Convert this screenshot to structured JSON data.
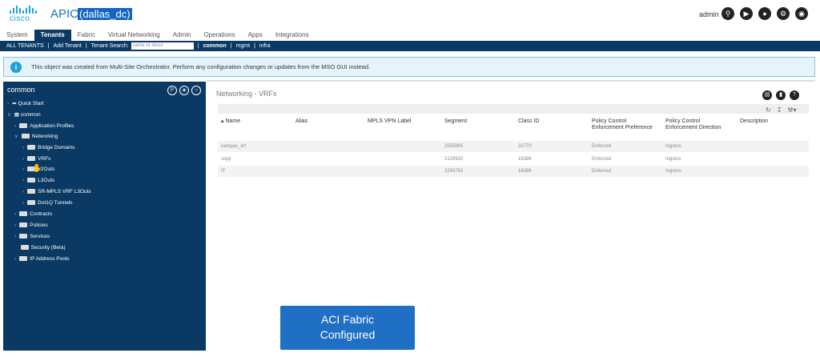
{
  "header": {
    "logo_text": "cisco",
    "app_name": "APIC",
    "site": "(dallas_dc)",
    "user": "admin"
  },
  "tabs": [
    "System",
    "Tenants",
    "Fabric",
    "Virtual Networking",
    "Admin",
    "Operations",
    "Apps",
    "Integrations"
  ],
  "subnav": {
    "all_tenants": "ALL TENANTS",
    "add_tenant": "Add Tenant",
    "tenant_search": "Tenant Search:",
    "search_placeholder": "name or descr",
    "common": "common",
    "mgmt": "mgmt",
    "infra": "infra"
  },
  "banner": {
    "message": "This object was created from Multi-Site Orchestrator. Perform any configuration changes or updates from the MSO GUI instead."
  },
  "sidebar": {
    "title": "common",
    "items": [
      {
        "label": "Quick Start"
      },
      {
        "label": "common"
      },
      {
        "label": "Application Profiles"
      },
      {
        "label": "Networking"
      },
      {
        "label": "Bridge Domains"
      },
      {
        "label": "VRFs"
      },
      {
        "label": "L2Outs"
      },
      {
        "label": "L3Outs"
      },
      {
        "label": "SR-MPLS VRF L3Outs"
      },
      {
        "label": "Dot1Q Tunnels"
      },
      {
        "label": "Contracts"
      },
      {
        "label": "Policies"
      },
      {
        "label": "Services"
      },
      {
        "label": "Security (Beta)"
      },
      {
        "label": "IP Address Pools"
      }
    ]
  },
  "main": {
    "title": "Networking - VRFs",
    "columns": [
      "Name",
      "Alias",
      "MPLS VPN Label",
      "Segment",
      "Class ID",
      "Policy Control Enforcement Preference",
      "Policy Control Enforcement Direction",
      "Description"
    ],
    "rows": [
      {
        "name": "campus_vrf",
        "alias": "",
        "mpls": "",
        "segment": "2555905",
        "class_id": "32770",
        "pref": "Enforced",
        "dir": "Ingress",
        "desc": ""
      },
      {
        "name": "copy",
        "alias": "",
        "mpls": "",
        "segment": "2129920",
        "class_id": "16386",
        "pref": "Enforced",
        "dir": "Ingress",
        "desc": ""
      },
      {
        "name": "IT",
        "alias": "",
        "mpls": "",
        "segment": "2293762",
        "class_id": "16386",
        "pref": "Enforced",
        "dir": "Ingress",
        "desc": ""
      }
    ]
  },
  "overlay": {
    "line1": "ACI Fabric",
    "line2": "Configured"
  }
}
